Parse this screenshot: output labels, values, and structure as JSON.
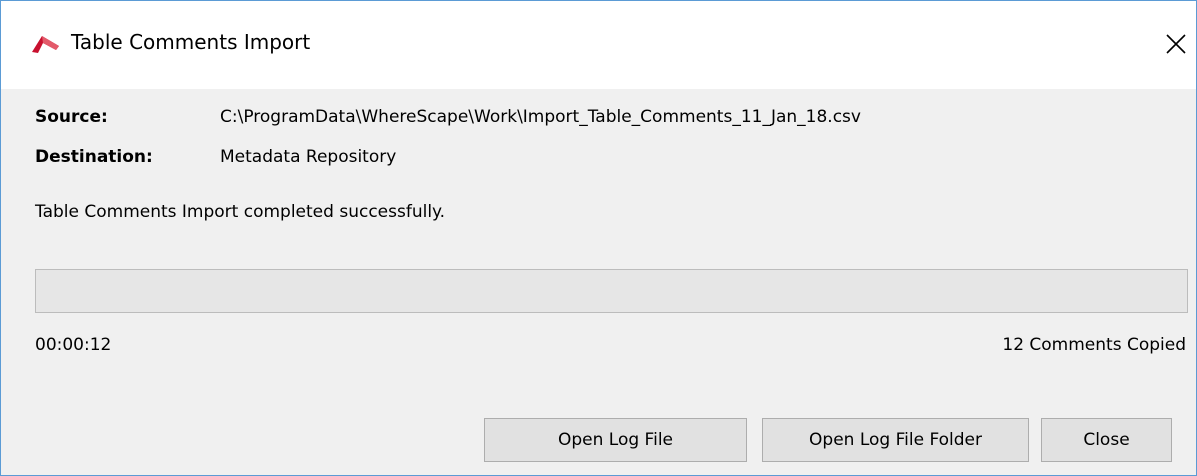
{
  "window": {
    "title": "Table Comments Import",
    "icon": "wherescape-logo-icon",
    "close_icon": "close-icon"
  },
  "details": {
    "source_label": "Source:",
    "source_value": "C:\\ProgramData\\WhereScape\\Work\\Import_Table_Comments_11_Jan_18.csv",
    "destination_label": "Destination:",
    "destination_value": "Metadata Repository"
  },
  "status_message": "Table Comments Import completed successfully.",
  "progress": {
    "percent": 0
  },
  "footer": {
    "elapsed": "00:00:12",
    "copied": "12 Comments Copied"
  },
  "buttons": {
    "open_log_file": "Open Log File",
    "open_log_folder": "Open Log File Folder",
    "close": "Close"
  },
  "colors": {
    "accent_border": "#5b9bd5",
    "logo_red": "#c8102e",
    "progress_fill": "#06b025"
  }
}
